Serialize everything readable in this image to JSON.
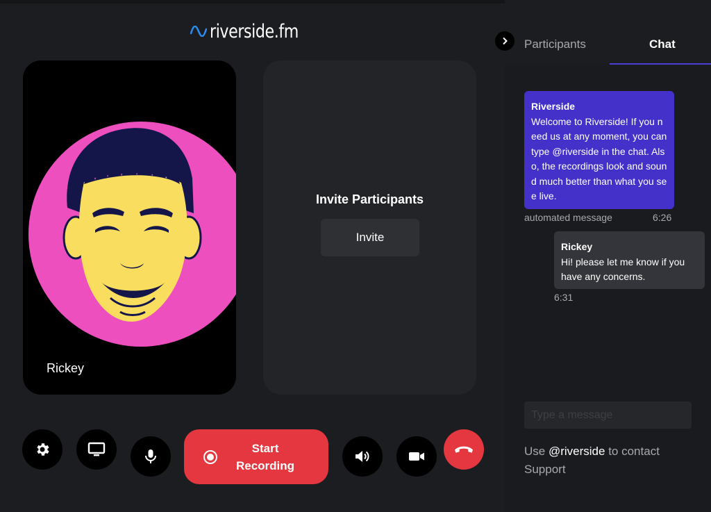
{
  "app": {
    "logo_text": "riverside.fm"
  },
  "stage": {
    "self_tile": {
      "name": "Rickey"
    },
    "invite_tile": {
      "title": "Invite Participants",
      "button_label": "Invite"
    }
  },
  "controls": {
    "start_recording_line1": "Start",
    "start_recording_line2": "Recording",
    "icons": [
      "gear-icon",
      "screen-share-icon",
      "microphone-icon",
      "record-icon",
      "speaker-icon",
      "camera-icon",
      "hang-up-icon"
    ]
  },
  "side_panel": {
    "tabs": [
      {
        "label": "Participants",
        "active": false
      },
      {
        "label": "Chat",
        "active": true
      }
    ],
    "messages": [
      {
        "author": "Riverside",
        "text": "Welcome to Riverside! If you need us at any moment, you can type @riverside in the chat. Also, the recordings look and sound much better than what you see live.",
        "note": "automated message",
        "time": "6:26"
      },
      {
        "author": "Rickey",
        "text": "Hi! please let me know if you have any concerns.",
        "time": "6:31"
      }
    ],
    "input_placeholder": "Type a message",
    "support": {
      "prefix": "Use",
      "mention": "@riverside",
      "suffix": "to contact Support"
    }
  },
  "colors": {
    "background": "#1c1d20",
    "accent_red": "#e5373f",
    "bot_message": "#4331c9",
    "tab_underline": "#4b40d6",
    "avatar_circle": "#ee4fbf",
    "avatar_face": "#f9dd5f",
    "avatar_hair": "#14164a",
    "logo_wave": "#2b8cf0"
  }
}
